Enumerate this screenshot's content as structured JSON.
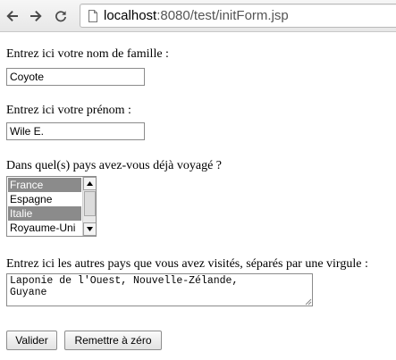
{
  "browser": {
    "url_host": "localhost",
    "url_rest": ":8080/test/initForm.jsp",
    "back_icon": "back-arrow-icon",
    "forward_icon": "forward-arrow-icon",
    "reload_icon": "reload-icon",
    "page_icon": "page-icon"
  },
  "form": {
    "nom": {
      "label": "Entrez ici votre nom de famille :",
      "value": "Coyote"
    },
    "prenom": {
      "label": "Entrez ici votre prénom :",
      "value": "Wile E."
    },
    "pays": {
      "label": "Dans quel(s) pays avez-vous déjà voyagé ?",
      "options": [
        {
          "label": "France",
          "selected": true
        },
        {
          "label": "Espagne",
          "selected": false
        },
        {
          "label": "Italie",
          "selected": true
        },
        {
          "label": "Royaume-Uni",
          "selected": false
        }
      ]
    },
    "autres": {
      "label": "Entrez ici les autres pays que vous avez visités, séparés par une virgule :",
      "value": "Laponie de l'Ouest, Nouvelle-Zélande,\nGuyane"
    },
    "submit_label": "Valider",
    "reset_label": "Remettre à zéro"
  },
  "colors": {
    "selection": "#8b8b8b",
    "field_border": "#8b8b8b"
  }
}
